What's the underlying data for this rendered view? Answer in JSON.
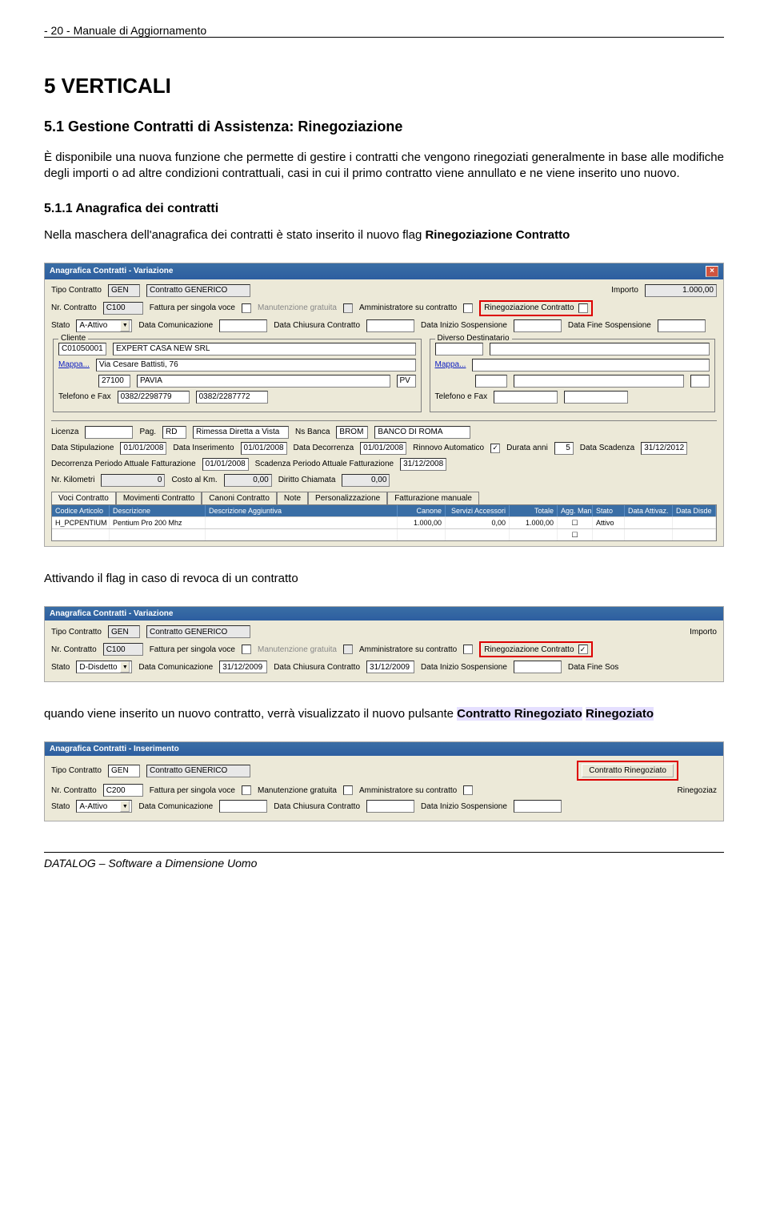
{
  "pageHeader": "- 20 -   Manuale di Aggiornamento",
  "section5": "5    VERTICALI",
  "section51": "5.1  Gestione Contratti di Assistenza: Rinegoziazione",
  "intro": "È disponibile una nuova funzione che permette di gestire i contratti che vengono rinegoziati generalmente in base alle modifiche degli importi o ad altre condizioni contrattuali, casi in cui il primo contratto viene annullato e ne viene inserito uno nuovo.",
  "section511": "5.1.1   Anagrafica dei contratti",
  "para511a": "Nella maschera dell'anagrafica dei contratti è stato inserito il nuovo flag ",
  "para511b": "Rinegoziazione Contratto",
  "mid1": "Attivando il flag in caso di revoca di un contratto",
  "mid2a": "quando viene inserito un nuovo contratto, verrà visualizzato il nuovo pulsante ",
  "mid2b": "Contratto Rinegoziato",
  "footer": "DATALOG – Software a Dimensione Uomo",
  "win1": {
    "title": "Anagrafica Contratti - Variazione",
    "labels": {
      "tipoContratto": "Tipo Contratto",
      "nrContratto": "Nr. Contratto",
      "stato": "Stato",
      "cliente": "Cliente",
      "telefonoFax": "Telefono e Fax",
      "mappa": "Mappa...",
      "licenza": "Licenza",
      "pag": "Pag.",
      "nsBanca": "Ns Banca",
      "dataStipulazione": "Data Stipulazione",
      "dataInserimento": "Data Inserimento",
      "dataDecorrenza": "Data Decorrenza",
      "rinnovoAuto": "Rinnovo Automatico",
      "durataAnni": "Durata anni",
      "dataScadenza": "Data Scadenza",
      "decorrenzaPeriodo": "Decorrenza Periodo Attuale Fatturazione",
      "scadenzaPeriodo": "Scadenza Periodo Attuale Fatturazione",
      "nrKm": "Nr. Kilometri",
      "costoKm": "Costo al Km.",
      "dirittoChiamata": "Diritto Chiamata",
      "fatturaSingola": "Fattura per singola voce",
      "manutenzioneGratuita": "Manutenzione gratuita",
      "ammSuContratto": "Amministratore su contratto",
      "rinegoziazione": "Rinegoziazione Contratto",
      "importo": "Importo",
      "dataComunicazione": "Data Comunicazione",
      "dataChiusura": "Data Chiusura Contratto",
      "dataInizioSosp": "Data Inizio Sospensione",
      "dataFineSosp": "Data Fine Sospensione",
      "diversoDest": "Diverso Destinatario"
    },
    "vals": {
      "tipoContratto": "GEN",
      "tipoContrattoDesc": "Contratto GENERICO",
      "nrContratto": "C100",
      "stato": "A-Attivo",
      "importo": "1.000,00",
      "clienteCod": "C01050001",
      "clienteNome": "EXPERT CASA NEW SRL",
      "clienteIndirizzo": "Via Cesare Battisti, 76",
      "clienteCap": "27100",
      "clienteCitta": "PAVIA",
      "clienteProv": "PV",
      "tel": "0382/2298779",
      "fax": "0382/2287772",
      "pag": "RD",
      "pagDesc": "Rimessa Diretta a Vista",
      "nsBanca": "BROM",
      "nsBancaDesc": "BANCO DI ROMA",
      "dataStip": "01/01/2008",
      "dataIns": "01/01/2008",
      "dataDec": "01/01/2008",
      "durata": "5",
      "dataScad": "31/12/2012",
      "decPer": "01/01/2008",
      "scadPer": "31/12/2008",
      "km": "0",
      "costoKm": "0,00",
      "diritto": "0,00"
    },
    "tabs": [
      "Voci Contratto",
      "Movimenti Contratto",
      "Canoni Contratto",
      "Note",
      "Personalizzazione",
      "Fatturazione manuale"
    ],
    "gridCols": [
      "Codice Articolo",
      "Descrizione",
      "Descrizione Aggiuntiva",
      "Canone",
      "Servizi Accessori",
      "Totale",
      "Agg. Man.",
      "Stato",
      "Data Attivaz.",
      "Data Disde"
    ],
    "gridRow": {
      "codice": "H_PCPENTIUM",
      "desc": "Pentium Pro 200 Mhz",
      "canone": "1.000,00",
      "serv": "0,00",
      "totale": "1.000,00",
      "stato": "Attivo"
    }
  },
  "win2": {
    "title": "Anagrafica Contratti - Variazione",
    "vals": {
      "tipoContratto": "GEN",
      "tipoContrattoDesc": "Contratto GENERICO",
      "nrContratto": "C100",
      "stato": "D-Disdetto",
      "importo": "Importo",
      "dataCom": "31/12/2009",
      "dataChiusura": "31/12/2009"
    },
    "labels": {
      "dataFineSos": "Data Fine Sos"
    }
  },
  "win3": {
    "title": "Anagrafica Contratti - Inserimento",
    "vals": {
      "tipoContratto": "GEN",
      "tipoContrattoDesc": "Contratto GENERICO",
      "nrContratto": "C200",
      "stato": "A-Attivo"
    },
    "labels": {
      "contrattoRineg": "Contratto Rinegoziato",
      "rinegoziaz": "Rinegoziaz"
    }
  }
}
